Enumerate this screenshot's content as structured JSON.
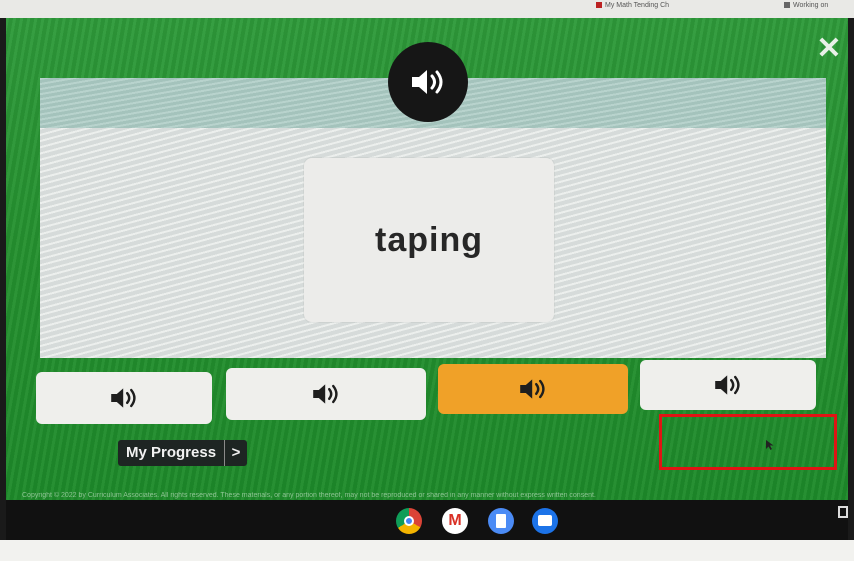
{
  "browser_bar": {
    "bookmarks": [
      "My Math Tending Ch",
      "Working on"
    ]
  },
  "card": {
    "word": "taping"
  },
  "buttons": {
    "close_label": "✕",
    "progress_label": "My Progress",
    "progress_arrow": ">"
  },
  "choices": [
    {
      "selected": false
    },
    {
      "selected": false
    },
    {
      "selected": true
    },
    {
      "selected": false
    }
  ],
  "icons": {
    "speaker": "speaker-icon",
    "close": "close-icon"
  },
  "colors": {
    "background_green": "#25912f",
    "selected_choice": "#f0a128",
    "highlight_box": "#e01414"
  },
  "footer": {
    "copyright": "Copyright © 2022 by Curriculum Associates. All rights reserved. These materials, or any portion thereof, may not be reproduced or shared in any manner without express written consent."
  },
  "taskbar": {
    "apps": [
      "chrome-icon",
      "gmail-icon",
      "docs-icon",
      "classroom-icon"
    ]
  }
}
